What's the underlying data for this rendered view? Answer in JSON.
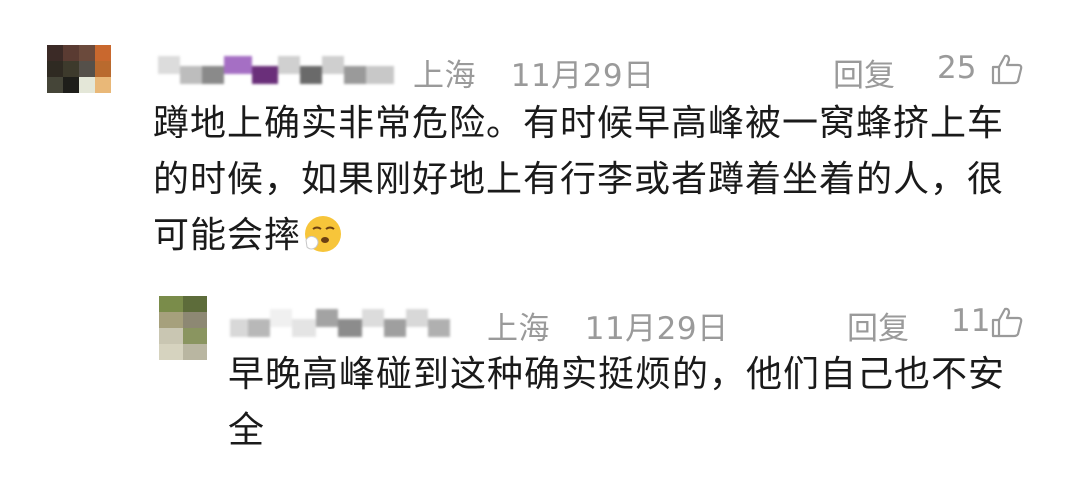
{
  "comments": [
    {
      "location": "上海",
      "date": "11月29日",
      "reply_label": "回复",
      "likes": "25",
      "text": "蹲地上确实非常危险。有时候早高峰被一窝蜂挤上车的时候，如果刚好地上有行李或者蹲着坐着的人，很可能会摔",
      "text_lines": [
        "蹲地上确实非常危险。有时候早高峰被一窝蜂挤上车",
        "的时候，如果刚好地上有行李或者蹲着坐着的人，很",
        "可能会摔"
      ],
      "emoji": "sneeze-emoji"
    },
    {
      "location": "上海",
      "date": "11月29日",
      "reply_label": "回复",
      "likes": "11",
      "text": "早晚高峰碰到这种确实挺烦的，他们自己也不安全",
      "text_lines": [
        "早晚高峰碰到这种确实挺烦的，他们自己也不安",
        "全"
      ]
    }
  ],
  "colors": {
    "meta": "#9a9a9a",
    "text": "#1a1a1a",
    "background": "#ffffff"
  }
}
